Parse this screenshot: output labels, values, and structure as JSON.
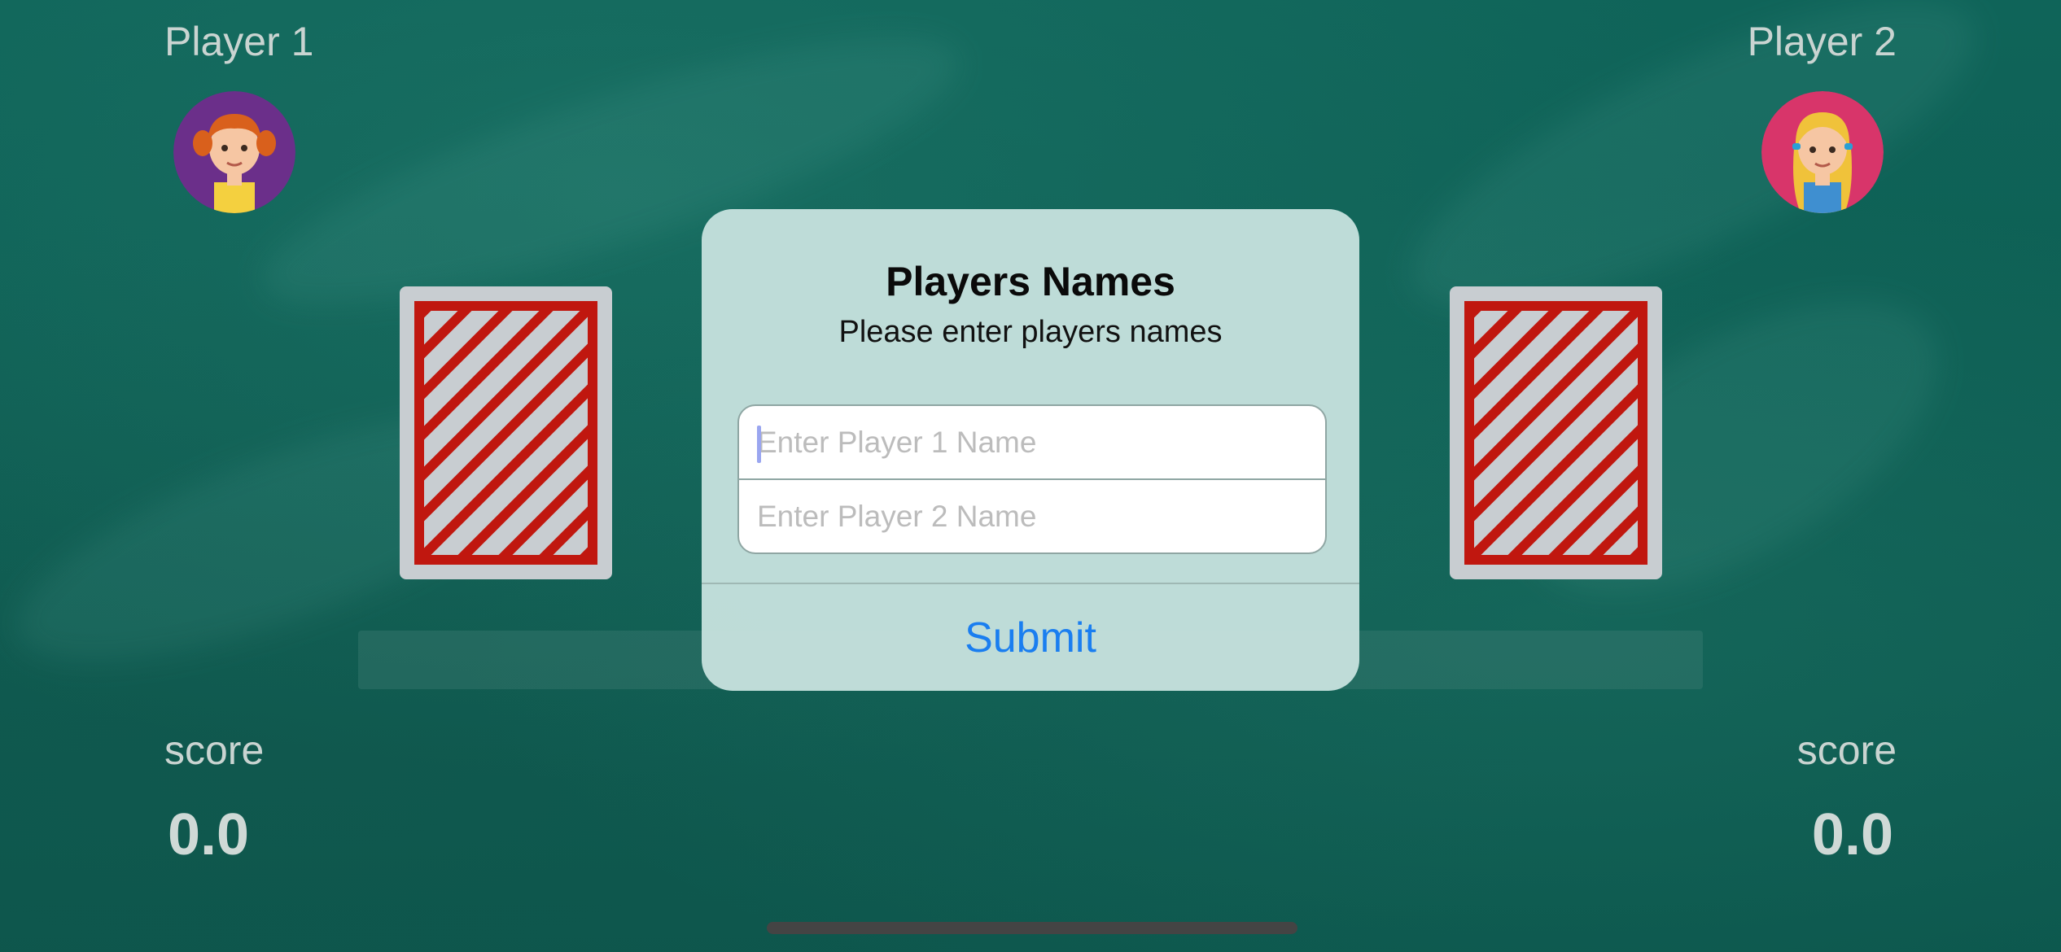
{
  "players": [
    {
      "label": "Player 1",
      "avatar_icon": "girl-redhead-avatar-icon",
      "avatar_bg": "#6b2f8a",
      "score_label": "score",
      "score_value": "0.0"
    },
    {
      "label": "Player 2",
      "avatar_icon": "girl-blonde-avatar-icon",
      "avatar_bg": "#d8356a",
      "score_label": "score",
      "score_value": "0.0"
    }
  ],
  "card_back": {
    "border_color": "#c0170f",
    "stripe_color": "#c8cdd1"
  },
  "dialog": {
    "title": "Players Names",
    "message": "Please enter players names",
    "player1_field": {
      "placeholder": "Enter Player 1 Name",
      "value": ""
    },
    "player2_field": {
      "placeholder": "Enter Player 2 Name",
      "value": ""
    },
    "submit_label": "Submit",
    "accent_color": "#1a7ef0"
  },
  "theme": {
    "background": "#0f6459",
    "text": "#c9d4d1"
  }
}
